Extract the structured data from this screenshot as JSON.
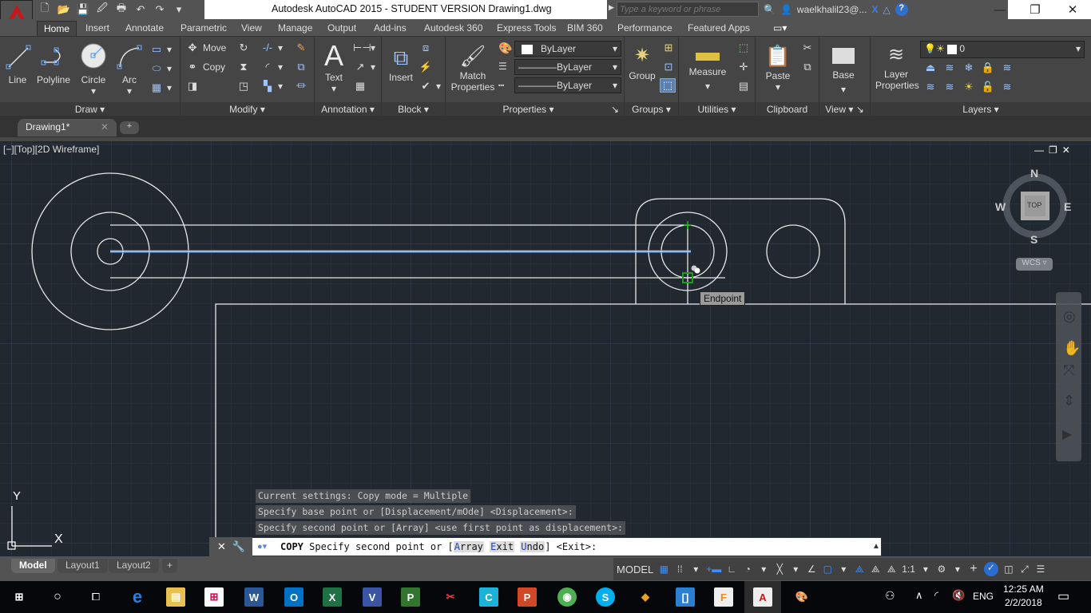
{
  "window": {
    "title": "Autodesk AutoCAD 2015 - STUDENT VERSION    Drawing1.dwg",
    "search_placeholder": "Type a keyword or phrase",
    "user": "waelkhalil23@...",
    "minimize_icon": "—",
    "restore_icon": "❐",
    "close_icon": "✕"
  },
  "quick_access": [
    "new-icon",
    "open-icon",
    "save-icon",
    "saveas-icon",
    "plot-icon",
    "undo-icon",
    "redo-icon",
    "customize-icon"
  ],
  "ribbon_tabs": [
    "Home",
    "Insert",
    "Annotate",
    "Parametric",
    "View",
    "Manage",
    "Output",
    "Add-ins",
    "Autodesk 360",
    "Express Tools",
    "BIM 360",
    "Performance",
    "Featured Apps"
  ],
  "ribbon": {
    "draw": {
      "title": "Draw",
      "line": "Line",
      "polyline": "Polyline",
      "circle": "Circle",
      "arc": "Arc"
    },
    "modify": {
      "title": "Modify",
      "move": "Move",
      "copy": "Copy"
    },
    "annotation": {
      "title": "Annotation",
      "text": "Text"
    },
    "block": {
      "title": "Block",
      "insert": "Insert"
    },
    "properties": {
      "title": "Properties",
      "match_line1": "Match",
      "match_line2": "Properties",
      "color": "ByLayer",
      "lineweight": "ByLayer",
      "linetype": "ByLayer"
    },
    "groups": {
      "title": "Groups",
      "group": "Group"
    },
    "utilities": {
      "title": "Utilities",
      "measure": "Measure"
    },
    "clipboard": {
      "title": "Clipboard",
      "paste": "Paste"
    },
    "view": {
      "title": "View",
      "base": "Base"
    },
    "layers": {
      "title": "Layers",
      "layer_line1": "Layer",
      "layer_line2": "Properties",
      "current_layer": "0"
    }
  },
  "document_tab": {
    "label": "Drawing1*",
    "close": "✕",
    "new": "+"
  },
  "viewport": {
    "label": "[−][Top][2D Wireframe]",
    "controls": "—❐✕",
    "osnap_tooltip": "Endpoint",
    "viewcube": {
      "n": "N",
      "s": "S",
      "e": "E",
      "w": "W",
      "face": "TOP",
      "ucs": "WCS"
    },
    "ucs_x": "X",
    "ucs_y": "Y"
  },
  "command": {
    "history": [
      "Current settings:  Copy mode = Multiple",
      "Specify base point or [Displacement/mOde] <Displacement>:",
      "Specify second point or [Array] <use first point as displacement>:"
    ],
    "name": "COPY",
    "prompt": "Specify second point or [",
    "options": [
      {
        "key": "A",
        "rest": "rray"
      },
      {
        "key": "E",
        "rest": "xit"
      },
      {
        "key": "U",
        "rest": "ndo"
      }
    ],
    "suffix": "] <Exit>:"
  },
  "layout_tabs": [
    {
      "label": "Model",
      "active": true
    },
    {
      "label": "Layout1",
      "active": false
    },
    {
      "label": "Layout2",
      "active": false
    }
  ],
  "statusbar": {
    "model": "MODEL",
    "scale": "1:1"
  },
  "taskbar": {
    "apps": [
      "Edge",
      "File Explorer",
      "Store",
      "Word",
      "Outlook",
      "Excel",
      "Visio",
      "Project",
      "Snipping Tool",
      "Cortana",
      "PowerPoint",
      "Chrome",
      "Skype",
      "App",
      "App",
      "Fusion 360",
      "AutoCAD",
      "Paint"
    ],
    "language": "ENG",
    "time": "12:25 AM",
    "date": "2/2/2018"
  },
  "colors": {
    "accent": "#3b82f6",
    "canvas": "#212830",
    "ribbon": "#454545",
    "selected_line": "#5b8fd6",
    "snap_marker": "#16a016"
  }
}
